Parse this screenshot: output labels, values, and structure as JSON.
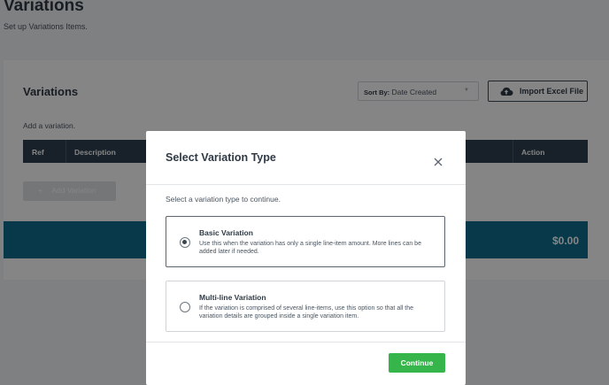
{
  "page": {
    "title": "Variations",
    "subtitle": "Set up Variations Items."
  },
  "card": {
    "title": "Variations",
    "sort_label": "Sort By:",
    "sort_value": "Date Created",
    "import_label": "Import Excel File",
    "add_hint": "Add a variation.",
    "columns": [
      "Ref",
      "Description",
      "Action"
    ],
    "add_button_label": "Add Variation",
    "total": "$0.00"
  },
  "modal": {
    "title": "Select Variation Type",
    "hint": "Select a variation type to continue.",
    "options": [
      {
        "title": "Basic Variation",
        "description": "Use this when the variation has only a single line-item amount. More lines can be added later if needed.",
        "selected": true
      },
      {
        "title": "Multi-line Variation",
        "description": "If the variation is comprised of several line-items, use this option so that all the variation details are grouped inside a single variation item.",
        "selected": false
      }
    ],
    "continue_label": "Continue"
  },
  "colors": {
    "table_header": "#2f3f4f",
    "total_bar": "#0f6e8e",
    "continue_button": "#36b54a",
    "overlay": "rgba(0,0,0,0.48)"
  }
}
